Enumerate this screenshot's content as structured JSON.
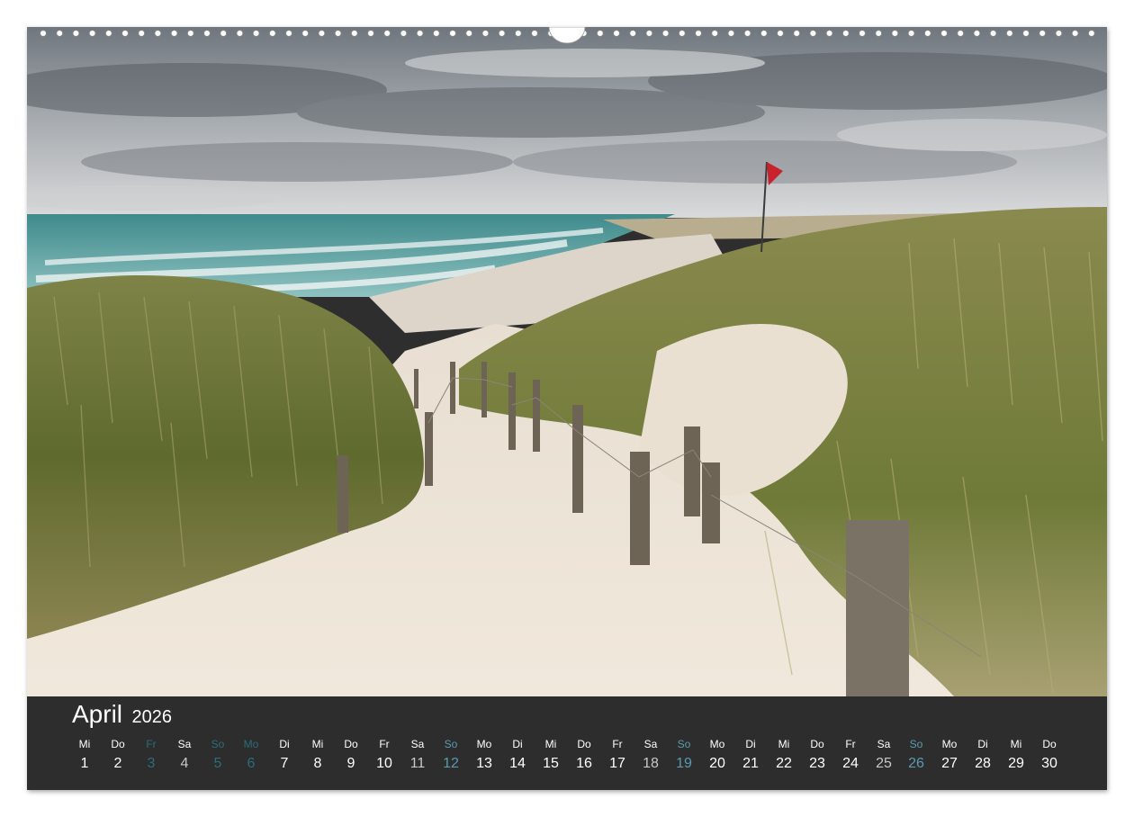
{
  "calendar": {
    "month": "April",
    "year": "2026",
    "days": [
      {
        "name": "Mi",
        "num": "1",
        "kind": "normal"
      },
      {
        "name": "Do",
        "num": "2",
        "kind": "normal"
      },
      {
        "name": "Fr",
        "num": "3",
        "kind": "holiday"
      },
      {
        "name": "Sa",
        "num": "4",
        "kind": "saturday"
      },
      {
        "name": "So",
        "num": "5",
        "kind": "holiday"
      },
      {
        "name": "Mo",
        "num": "6",
        "kind": "holiday"
      },
      {
        "name": "Di",
        "num": "7",
        "kind": "normal"
      },
      {
        "name": "Mi",
        "num": "8",
        "kind": "normal"
      },
      {
        "name": "Do",
        "num": "9",
        "kind": "normal"
      },
      {
        "name": "Fr",
        "num": "10",
        "kind": "normal"
      },
      {
        "name": "Sa",
        "num": "11",
        "kind": "saturday"
      },
      {
        "name": "So",
        "num": "12",
        "kind": "sunday"
      },
      {
        "name": "Mo",
        "num": "13",
        "kind": "normal"
      },
      {
        "name": "Di",
        "num": "14",
        "kind": "normal"
      },
      {
        "name": "Mi",
        "num": "15",
        "kind": "normal"
      },
      {
        "name": "Do",
        "num": "16",
        "kind": "normal"
      },
      {
        "name": "Fr",
        "num": "17",
        "kind": "normal"
      },
      {
        "name": "Sa",
        "num": "18",
        "kind": "saturday"
      },
      {
        "name": "So",
        "num": "19",
        "kind": "sunday"
      },
      {
        "name": "Mo",
        "num": "20",
        "kind": "normal"
      },
      {
        "name": "Di",
        "num": "21",
        "kind": "normal"
      },
      {
        "name": "Mi",
        "num": "22",
        "kind": "normal"
      },
      {
        "name": "Do",
        "num": "23",
        "kind": "normal"
      },
      {
        "name": "Fr",
        "num": "24",
        "kind": "normal"
      },
      {
        "name": "Sa",
        "num": "25",
        "kind": "saturday"
      },
      {
        "name": "So",
        "num": "26",
        "kind": "sunday"
      },
      {
        "name": "Mo",
        "num": "27",
        "kind": "normal"
      },
      {
        "name": "Di",
        "num": "28",
        "kind": "normal"
      },
      {
        "name": "Mi",
        "num": "29",
        "kind": "normal"
      },
      {
        "name": "Do",
        "num": "30",
        "kind": "normal"
      }
    ]
  },
  "colors": {
    "calendar_bg": "#2d2d2d",
    "sunday": "#5a9bb0",
    "holiday": "#2c6c7c",
    "flag": "#c8232c"
  },
  "photo": {
    "icon": "beach-dunes-photo"
  }
}
